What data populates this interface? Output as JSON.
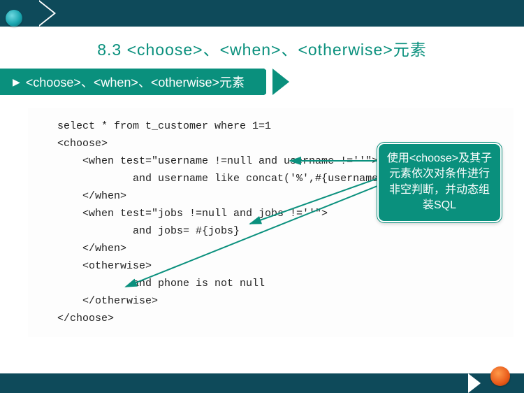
{
  "title": "8.3 <choose>、<when>、<otherwise>元素",
  "section": "<choose>、<when>、<otherwise>元素",
  "callout": "使用<choose>及其子元素依次对条件进行非空判断，并动态组装SQL",
  "code": {
    "l1": "select * from t_customer where 1=1",
    "l2": "<choose>",
    "l3": "    <when test=\"username !=null and username !=''\">",
    "l4": "            and username like concat('%',#{username},'%')",
    "l5": "    </when>",
    "l6": "    <when test=\"jobs !=null and jobs !=''\">",
    "l7": "            and jobs= #{jobs}",
    "l8": "    </when>",
    "l9": "    <otherwise>",
    "l10": "            and phone is not null",
    "l11": "    </otherwise>",
    "l12": "</choose>"
  }
}
